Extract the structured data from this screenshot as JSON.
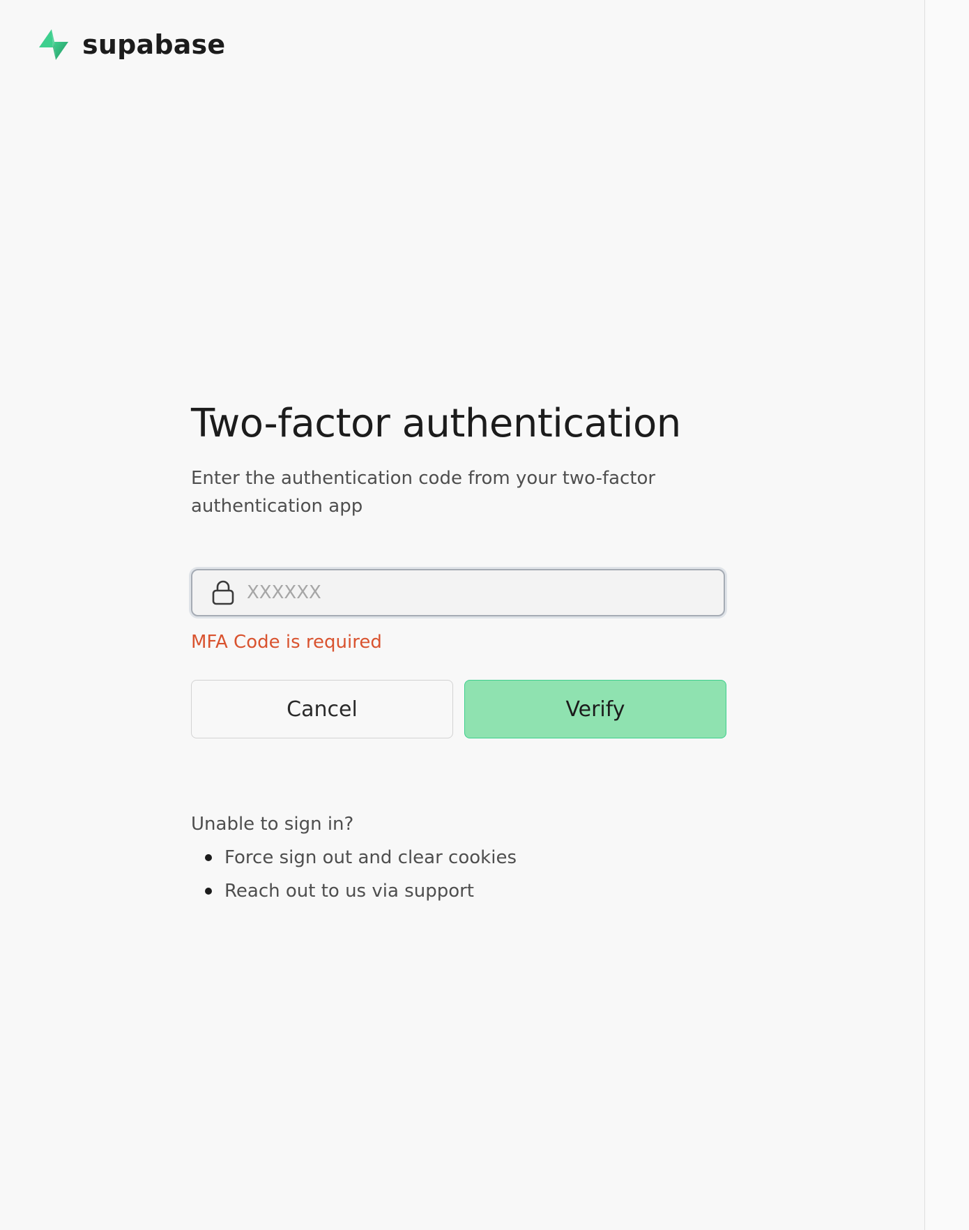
{
  "brand": {
    "name": "supabase",
    "logo_icon": "supabase-bolt-icon",
    "accent_color": "#3ecf8e"
  },
  "page": {
    "title": "Two-factor authentication",
    "subtitle": "Enter the authentication code from your two-factor authentication app"
  },
  "mfa_input": {
    "icon": "lock-icon",
    "value": "",
    "placeholder": "XXXXXX"
  },
  "error": {
    "message": "MFA Code is required",
    "color": "#d9532f"
  },
  "buttons": {
    "cancel_label": "Cancel",
    "verify_label": "Verify"
  },
  "help": {
    "title": "Unable to sign in?",
    "items": [
      "Force sign out and clear cookies",
      "Reach out to us via support"
    ]
  }
}
